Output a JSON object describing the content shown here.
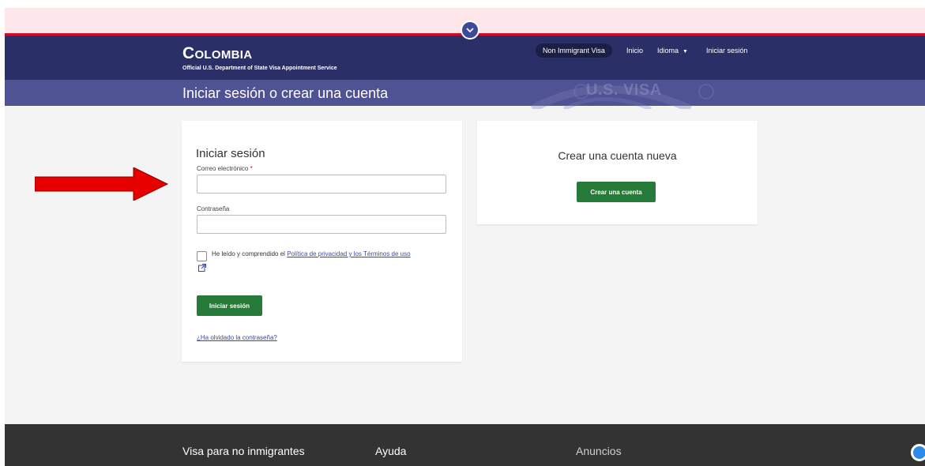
{
  "header": {
    "brand_title": "Colombia",
    "brand_subtitle": "Official U.S. Department of State Visa Appointment Service",
    "nav": {
      "pill": "Non Immigrant Visa",
      "home": "Inicio",
      "language": "Idioma",
      "signin": "Iniciar sesión"
    }
  },
  "title_bar": {
    "title": "Iniciar sesión o crear una cuenta",
    "seal_text": "U.S. VISA"
  },
  "login": {
    "heading": "Iniciar sesión",
    "email_label": "Correo electrónico",
    "required_mark": "*",
    "email_value": "",
    "password_label": "Contraseña",
    "password_value": "",
    "consent_text": "He leído y comprendido el",
    "consent_link": "Política de privacidad y los Términos de uso",
    "submit": "Iniciar sesión",
    "forgot": "¿Ha olvidado la contraseña?"
  },
  "new_account": {
    "heading": "Crear una cuenta nueva",
    "button": "Crear una cuenta"
  },
  "footer": {
    "col1": "Visa para no inmigrantes",
    "col2": "Ayuda",
    "col3": "Anuncios"
  },
  "colors": {
    "navbar": "#2b2f67",
    "titlebar": "#4f5293",
    "accent_green": "#267a3a",
    "alert_red": "#c8102e",
    "arrow_red": "#e60000",
    "footer": "#333333"
  },
  "icons": [
    "chevron-down-icon",
    "external-link-icon",
    "red-arrow-annotation",
    "help-chat-icon"
  ]
}
